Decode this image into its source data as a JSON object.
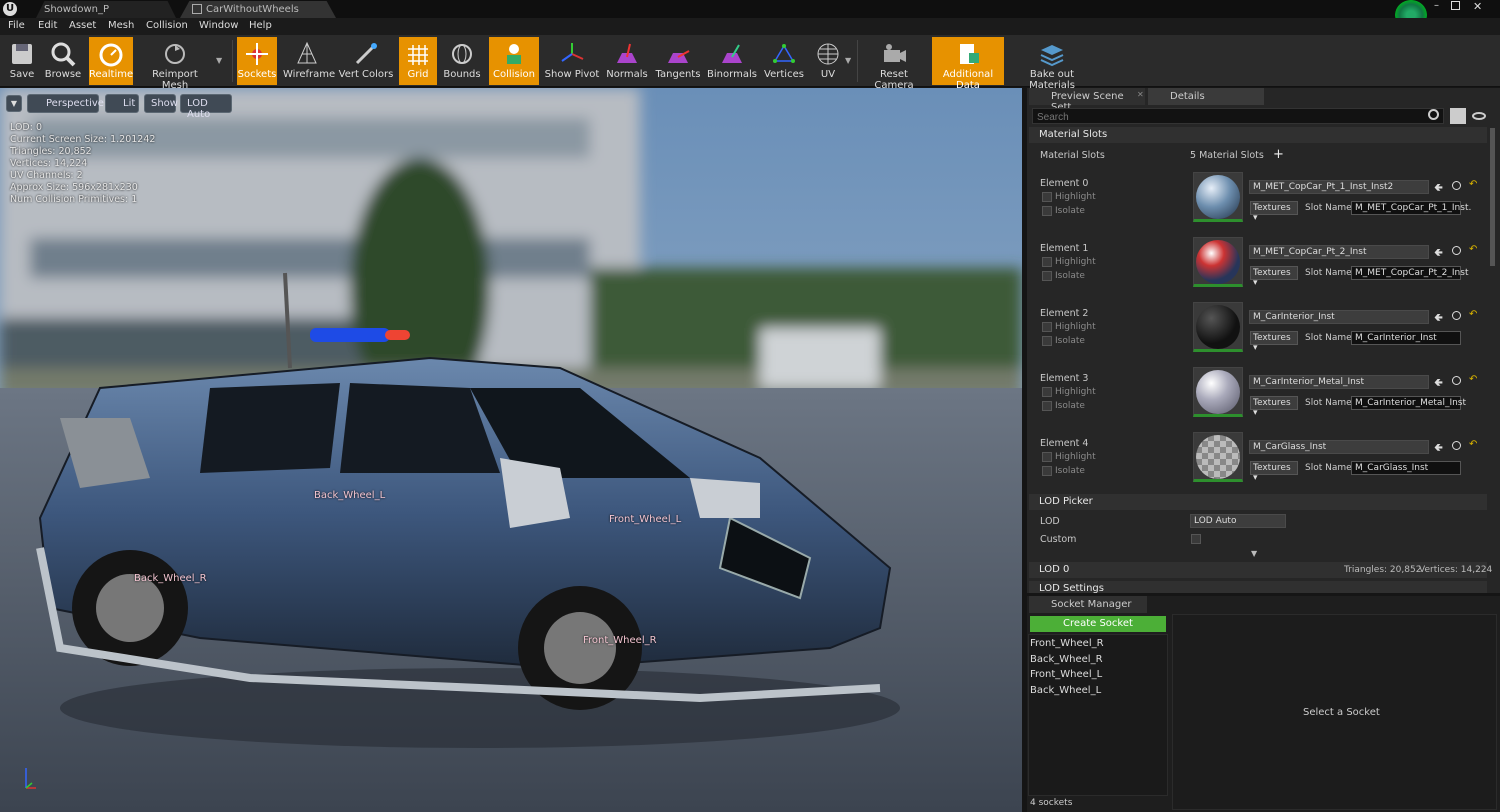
{
  "window": {
    "tabs": [
      "Showdown_P",
      "CarWithoutWheels"
    ]
  },
  "menu": [
    "File",
    "Edit",
    "Asset",
    "Mesh",
    "Collision",
    "Window",
    "Help"
  ],
  "toolbar": [
    "Save",
    "Browse",
    "Realtime",
    "Reimport Mesh",
    "Sockets",
    "Wireframe",
    "Vert Colors",
    "Grid",
    "Bounds",
    "Collision",
    "Show Pivot",
    "Normals",
    "Tangents",
    "Binormals",
    "Vertices",
    "UV",
    "Reset Camera",
    "Additional Data",
    "Bake out Materials"
  ],
  "viewport": {
    "buttons": [
      "Perspective",
      "Lit",
      "Show",
      "LOD Auto"
    ],
    "stats": [
      "LOD:  0",
      "Current Screen Size:  1.201242",
      "Triangles:  20,852",
      "Vertices:  14,224",
      "UV Channels:  2",
      "Approx Size: 596x281x230",
      "Num Collision Primitives:  1"
    ],
    "sockets": [
      "Back_Wheel_L",
      "Front_Wheel_L",
      "Back_Wheel_R",
      "Front_Wheel_R"
    ]
  },
  "panel": {
    "tabs": [
      "Preview Scene Sett",
      "Details"
    ],
    "search_placeholder": "Search",
    "material_slots": {
      "header": "Material Slots",
      "label": "Material Slots",
      "count": "5 Material Slots",
      "elements": [
        {
          "label": "Element 0",
          "material": "M_MET_CopCar_Pt_1_Inst_Inst2",
          "slot": "M_MET_CopCar_Pt_1_Inst."
        },
        {
          "label": "Element 1",
          "material": "M_MET_CopCar_Pt_2_Inst",
          "slot": "M_MET_CopCar_Pt_2_Inst"
        },
        {
          "label": "Element 2",
          "material": "M_CarInterior_Inst",
          "slot": "M_CarInterior_Inst"
        },
        {
          "label": "Element 3",
          "material": "M_CarInterior_Metal_Inst",
          "slot": "M_CarInterior_Metal_Inst"
        },
        {
          "label": "Element 4",
          "material": "M_CarGlass_Inst",
          "slot": "M_CarGlass_Inst"
        }
      ],
      "highlight": "Highlight",
      "isolate": "Isolate",
      "textures": "Textures",
      "slot_name": "Slot Name"
    },
    "lod_picker": {
      "header": "LOD Picker",
      "lod_label": "LOD",
      "lod_value": "LOD Auto",
      "custom_label": "Custom"
    },
    "lod0": {
      "header": "LOD 0",
      "triangles": "Triangles: 20,852",
      "vertices": "Vertices: 14,224"
    },
    "lod_settings": "LOD Settings"
  },
  "socket_manager": {
    "tab": "Socket Manager",
    "create": "Create Socket",
    "items": [
      "Front_Wheel_R",
      "Back_Wheel_R",
      "Front_Wheel_L",
      "Back_Wheel_L"
    ],
    "empty": "Select a Socket",
    "count": "4 sockets"
  }
}
